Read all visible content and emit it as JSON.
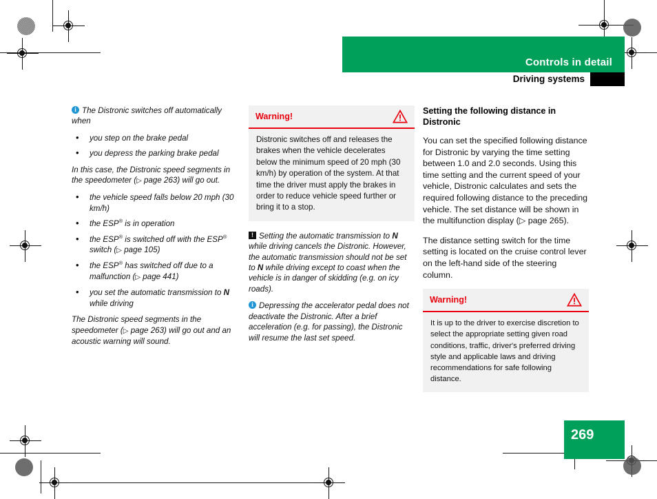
{
  "header": {
    "title": "Controls in detail",
    "subtitle": "Driving systems"
  },
  "page": {
    "number": "269"
  },
  "columns": {
    "left": {
      "intro_note": "The Distronic switches off automatically when",
      "bullets_1": [
        "you step on the brake pedal",
        "you depress the parking brake pedal"
      ],
      "mid_note": "In this case, the Distronic speed segments in the speedometer (▷ page 263) will go out.",
      "bullets_2": [
        "the vehicle speed falls below 20 mph (30 km/h)",
        "the ESP® is in operation",
        "the ESP® is switched off with the ESP® switch (▷ page 105)",
        "the ESP® has switched off due to a malfunction (▷ page 441)",
        "you set the automatic transmission to N while driving"
      ],
      "end_note": "The Distronic speed segments in the speedometer (▷ page 263) will go out and an acoustic warning will sound."
    },
    "middle": {
      "warning": {
        "title": "Warning!",
        "body": "Distronic switches off and releases the brakes when the vehicle decelerates below the minimum speed of 20 mph (30 km/h) by operation of the system. At that time the driver must apply the brakes in order to reduce vehicle speed further or bring it to a stop."
      },
      "caution_note": "Setting the automatic transmission to N while driving cancels the Distronic. However, the automatic transmission should not be set to N while driving except to coast when the vehicle is in danger of skidding (e.g. on icy roads).",
      "info_note": "Depressing the accelerator pedal does not deactivate the Distronic. After a brief acceleration (e.g. for passing), the Distronic will resume the last set speed."
    },
    "right": {
      "heading": "Setting the following distance in Distronic",
      "para_1": "You can set the specified following distance for Distronic by varying the time setting between 1.0 and 2.0 seconds. Using this time setting and the current speed of your vehicle, Distronic calculates and sets the required following distance to the preceding vehicle. The set distance will be shown in the multifunction display (▷ page 265).",
      "para_2": "The distance setting switch for the time setting is located on the cruise control lever on the left-hand side of the steering column.",
      "warning": {
        "title": "Warning!",
        "body": "It is up to the driver to exercise discretion to select the appropriate setting given road conditions, traffic, driver's preferred driving style and applicable laws and driving recommendations for safe following distance."
      }
    }
  },
  "colors": {
    "brand_green": "#00a05a",
    "warning_red": "#e8000d",
    "info_blue": "#2196d6",
    "box_gray": "#f1f1f1"
  },
  "icons": {
    "info": "info-icon",
    "caution": "caution-icon",
    "warning_triangle": "warning-triangle-icon"
  }
}
